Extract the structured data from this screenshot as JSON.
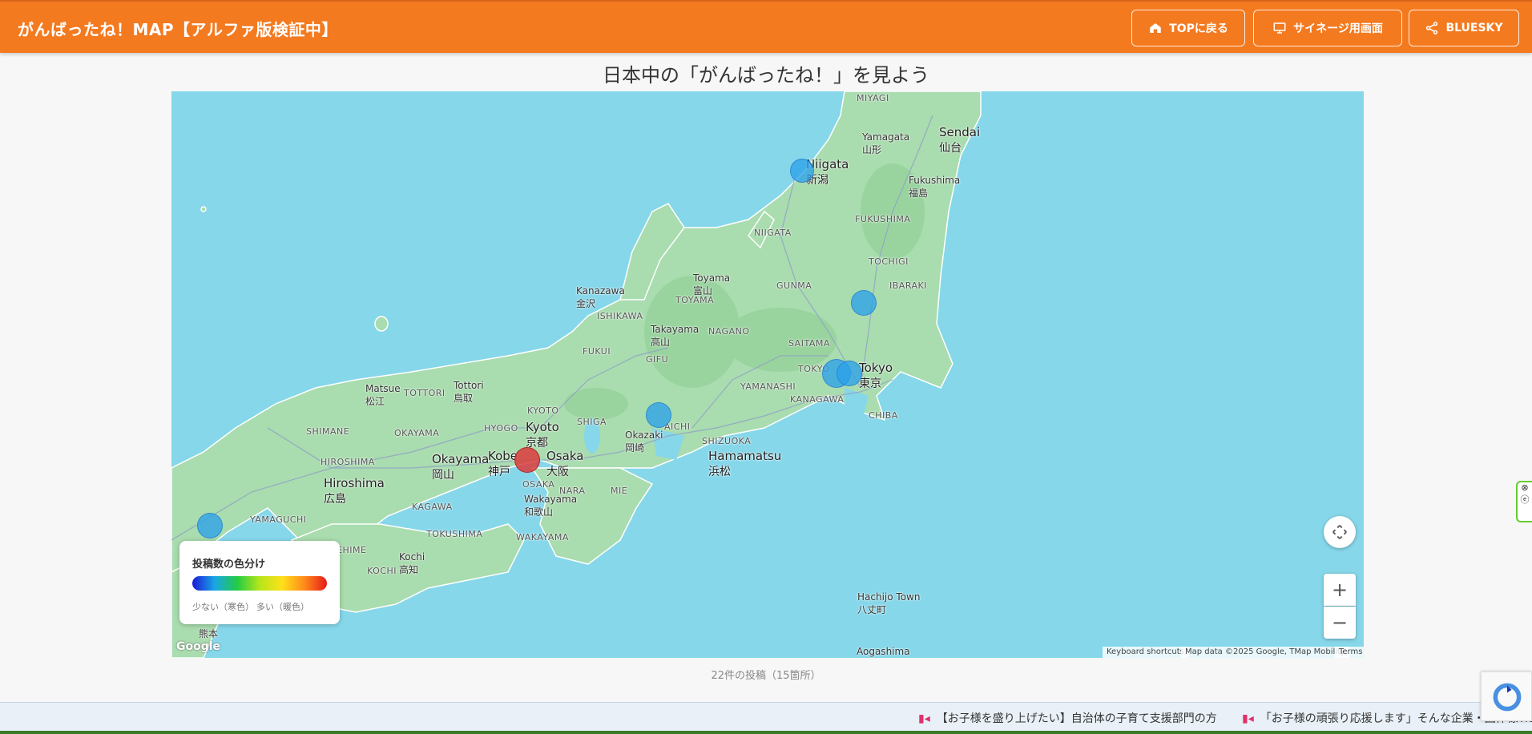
{
  "header": {
    "title": "がんばったね！MAP【アルファ版検証中】",
    "buttons": {
      "top": "TOPに戻る",
      "signage": "サイネージ用画面",
      "bluesky": "BLUESKY"
    }
  },
  "heading": "日本中の「がんばったね！」を見よう",
  "map": {
    "labels": {
      "miyagi": "MIYAGI",
      "sendai": "Sendai",
      "sendai_ja": "仙台",
      "yamagata": "Yamagata",
      "yamagata_ja": "山形",
      "niigata": "Niigata",
      "niigata_ja": "新潟",
      "fukushima": "Fukushima",
      "fukushima_ja": "福島",
      "niigata_pref": "NIIGATA",
      "fukushima_pref": "FUKUSHIMA",
      "tochigi": "TOCHIGI",
      "toyama": "Toyama",
      "toyama_ja": "富山",
      "kanazawa": "Kanazawa",
      "kanazawa_ja": "金沢",
      "toyama_pref": "TOYAMA",
      "gunma": "GUNMA",
      "ibaraki": "IBARAKI",
      "ishikawa": "ISHIKAWA",
      "takayama": "Takayama",
      "takayama_ja": "高山",
      "nagano": "NAGANO",
      "saitama": "SAITAMA",
      "fukui": "FUKUI",
      "gifu": "GIFU",
      "tokyo": "Tokyo",
      "tokyo_ja": "東京",
      "tokyo_pref": "TOKYO",
      "yamanashi": "YAMANASHI",
      "kanagawa": "KANAGAWA",
      "chiba": "CHIBA",
      "tottori": "Tottori",
      "tottori_ja": "鳥取",
      "matsue": "Matsue",
      "matsue_ja": "松江",
      "tottori_pref": "TOTTORI",
      "kyoto_pref": "KYOTO",
      "hyogo": "HYOGO",
      "kyoto": "Kyoto",
      "kyoto_ja": "京都",
      "shiga": "SHIGA",
      "aichi": "AICHI",
      "shimane": "SHIMANE",
      "okayama_pref": "OKAYAMA",
      "okazaki": "Okazaki",
      "okazaki_ja": "岡崎",
      "shizuoka": "SHIZUOKA",
      "hiroshima_pref": "HIROSHIMA",
      "okayama": "Okayama",
      "okayama_ja": "岡山",
      "kobe": "Kobe",
      "kobe_ja": "神戸",
      "osaka": "Osaka",
      "osaka_ja": "大阪",
      "hamamatsu": "Hamamatsu",
      "hamamatsu_ja": "浜松",
      "hiroshima": "Hiroshima",
      "hiroshima_ja": "広島",
      "osaka_pref": "OSAKA",
      "nara": "NARA",
      "kagawa": "KAGAWA",
      "wakayama": "Wakayama",
      "wakayama_ja": "和歌山",
      "mie": "MIE",
      "yamaguchi": "YAMAGUCHI",
      "tokushima": "TOKUSHIMA",
      "wakayama_pref": "WAKAYAMA",
      "ehime": "EHIME",
      "kochi": "Kochi",
      "kochi_ja": "高知",
      "kochi_pref": "KOCHI",
      "hachijo": "Hachijo Town",
      "hachijo_ja": "八丈町",
      "kumamoto_ja": "熊本",
      "aogashima": "Aogashima"
    },
    "legend": {
      "title": "投稿数の色分け",
      "low": "少ない（寒色）",
      "high": "多い（暖色）"
    },
    "controls": {
      "zoom_in": "+",
      "zoom_out": "−"
    },
    "attribution": {
      "shortcuts": "Keyboard shortcuts",
      "data": "Map data ©2025 Google, TMap Mobility",
      "terms": "Terms"
    },
    "logo": "Google"
  },
  "post_count": "22件の投稿（15箇所）",
  "ticker": {
    "items": [
      "【お子様を盛り上げたい】自治体の子育て支援部門の方",
      "「お子様の頑張り応援します」そんな企業・団体様Tic"
    ]
  }
}
